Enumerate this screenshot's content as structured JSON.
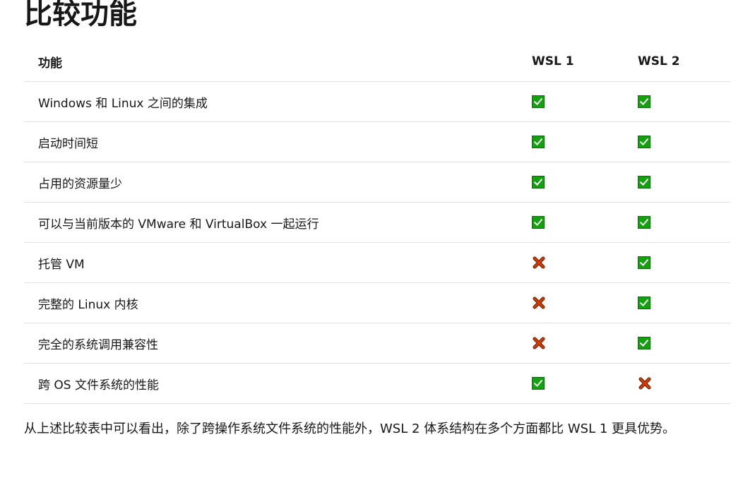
{
  "page": {
    "title": "比较功能",
    "summary": "从上述比较表中可以看出，除了跨操作系统文件系统的性能外，WSL 2 体系结构在多个方面都比 WSL 1 更具优势。"
  },
  "table": {
    "headers": [
      "功能",
      "WSL 1",
      "WSL 2"
    ],
    "rows": [
      {
        "feature": "Windows 和 Linux 之间的集成",
        "wsl1": "yes",
        "wsl2": "yes"
      },
      {
        "feature": "启动时间短",
        "wsl1": "yes",
        "wsl2": "yes"
      },
      {
        "feature": "占用的资源量少",
        "wsl1": "yes",
        "wsl2": "yes"
      },
      {
        "feature": "可以与当前版本的 VMware 和 VirtualBox 一起运行",
        "wsl1": "yes",
        "wsl2": "yes"
      },
      {
        "feature": "托管 VM",
        "wsl1": "no",
        "wsl2": "yes"
      },
      {
        "feature": "完整的 Linux 内核",
        "wsl1": "no",
        "wsl2": "yes"
      },
      {
        "feature": "完全的系统调用兼容性",
        "wsl1": "no",
        "wsl2": "yes"
      },
      {
        "feature": "跨 OS 文件系统的性能",
        "wsl1": "yes",
        "wsl2": "no"
      }
    ]
  },
  "icons": {
    "yes": "check-mark-icon",
    "no": "cross-mark-icon"
  },
  "colors": {
    "check_fill": "#13a10e",
    "cross_fill": "#d83b01",
    "cross_outline": "#5a1a00"
  }
}
